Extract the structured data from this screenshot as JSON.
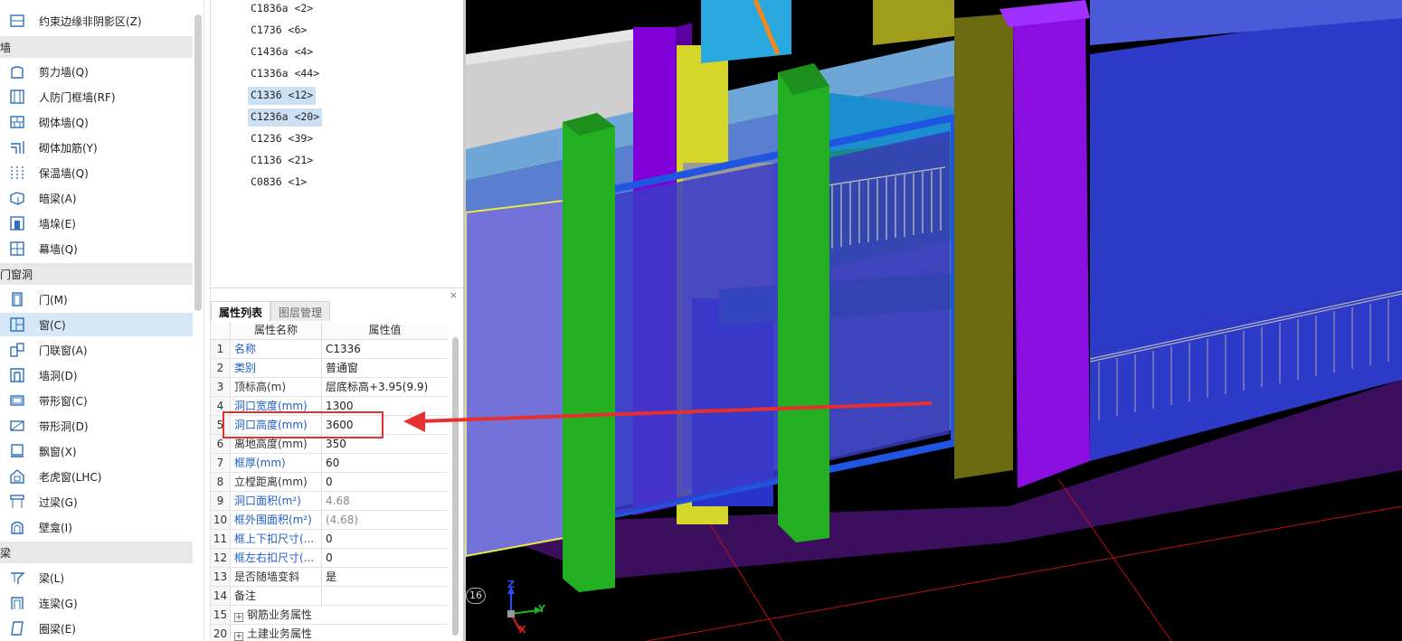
{
  "nav": {
    "top_item_label": "约束边缘非阴影区(Z)",
    "categories": [
      {
        "label": "墙"
      },
      {
        "label": "门窗洞"
      },
      {
        "label": "梁"
      }
    ],
    "wall_items": [
      {
        "label": "剪力墙(Q)"
      },
      {
        "label": "人防门框墙(RF)"
      },
      {
        "label": "砌体墙(Q)"
      },
      {
        "label": "砌体加筋(Y)"
      },
      {
        "label": "保温墙(Q)"
      },
      {
        "label": "暗梁(A)"
      },
      {
        "label": "墙垛(E)"
      },
      {
        "label": "幕墙(Q)"
      }
    ],
    "opening_items": [
      {
        "label": "门(M)"
      },
      {
        "label": "窗(C)"
      },
      {
        "label": "门联窗(A)"
      },
      {
        "label": "墙洞(D)"
      },
      {
        "label": "带形窗(C)"
      },
      {
        "label": "带形洞(D)"
      },
      {
        "label": "飘窗(X)"
      },
      {
        "label": "老虎窗(LHC)"
      },
      {
        "label": "过梁(G)"
      },
      {
        "label": "壁龛(I)"
      }
    ],
    "beam_items": [
      {
        "label": "梁(L)"
      },
      {
        "label": "连梁(G)"
      },
      {
        "label": "圈梁(E)"
      }
    ]
  },
  "component_list": [
    {
      "label": "C1836a <2>"
    },
    {
      "label": "C1736 <6>"
    },
    {
      "label": "C1436a <4>"
    },
    {
      "label": "C1336a <44>"
    },
    {
      "label": "C1336 <12>"
    },
    {
      "label": "C1236a <20>"
    },
    {
      "label": "C1236 <39>"
    },
    {
      "label": "C1136 <21>"
    },
    {
      "label": "C0836 <1>"
    }
  ],
  "properties": {
    "tabs": [
      "属性列表",
      "图层管理"
    ],
    "close_glyph": "×",
    "header": {
      "num": "",
      "name": "属性名称",
      "value": "属性值"
    },
    "rows": [
      {
        "num": "1",
        "name": "名称",
        "value": "C1336"
      },
      {
        "num": "2",
        "name": "类别",
        "value": "普通窗"
      },
      {
        "num": "3",
        "name": "顶标高(m)",
        "value": "层底标高+3.95(9.9)"
      },
      {
        "num": "4",
        "name": "洞口宽度(mm)",
        "value": "1300"
      },
      {
        "num": "5",
        "name": "洞口高度(mm)",
        "value": "3600"
      },
      {
        "num": "6",
        "name": "离地高度(mm)",
        "value": "350"
      },
      {
        "num": "7",
        "name": "框厚(mm)",
        "value": "60"
      },
      {
        "num": "8",
        "name": "立樘距离(mm)",
        "value": "0"
      },
      {
        "num": "9",
        "name": "洞口面积(m²)",
        "value": "4.68"
      },
      {
        "num": "10",
        "name": "框外围面积(m²)",
        "value": "(4.68)"
      },
      {
        "num": "11",
        "name": "框上下扣尺寸(...",
        "value": "0"
      },
      {
        "num": "12",
        "name": "框左右扣尺寸(...",
        "value": "0"
      },
      {
        "num": "13",
        "name": "是否随墙变斜",
        "value": "是"
      },
      {
        "num": "14",
        "name": "备注",
        "value": ""
      },
      {
        "num": "15",
        "name": "钢筋业务属性",
        "value": ""
      },
      {
        "num": "20",
        "name": "土建业务属性",
        "value": ""
      }
    ]
  },
  "viewport": {
    "axis_badge": "16",
    "axis_z": "Z",
    "axis_y": "Y",
    "axis_x": "X"
  },
  "colors": {
    "selection": "#d6e8f8",
    "property_link": "#1f5fc2",
    "annotation_red": "#e63030"
  }
}
